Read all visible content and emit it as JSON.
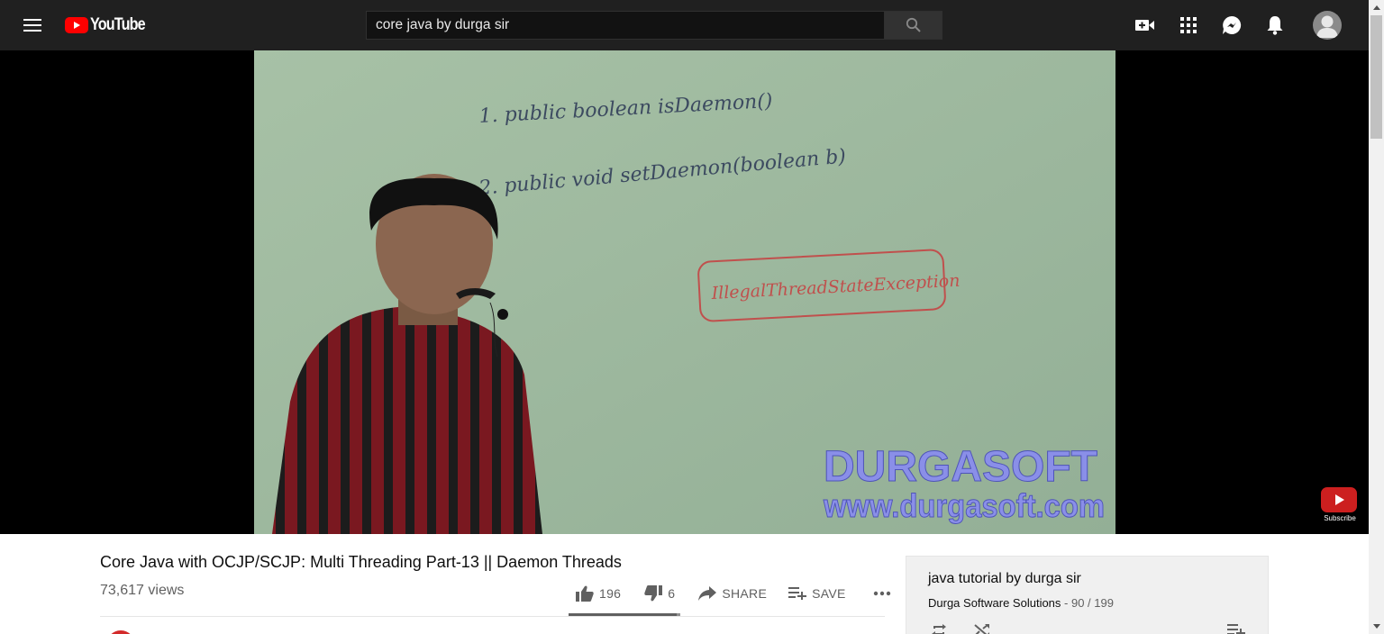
{
  "masthead": {
    "menu_icon": "hamburger-menu-icon",
    "logo_text": "YouTube",
    "search": {
      "value": "core java by durga sir",
      "placeholder": "Search"
    },
    "icons": [
      "create-video-icon",
      "apps-grid-icon",
      "messages-icon",
      "notifications-bell-icon",
      "account-avatar-icon"
    ]
  },
  "player": {
    "whiteboard": {
      "line1": "1. public boolean isDaemon()",
      "line2": "2. public void setDaemon(boolean b)",
      "exception": "IllegalThreadStateException"
    },
    "watermark_title": "DURGASOFT",
    "watermark_url": "www.durgasoft.com",
    "subscribe_label": "Subscribe"
  },
  "video": {
    "title": "Core Java with OCJP/SCJP: Multi Threading Part-13 || Daemon Threads",
    "views": "73,617 views",
    "likes": "196",
    "dislikes": "6",
    "share_label": "SHARE",
    "save_label": "SAVE",
    "like_ratio": 0.97
  },
  "playlist": {
    "title": "java tutorial by durga sir",
    "owner": "Durga Software Solutions",
    "position": " - 90 / 199"
  },
  "colors": {
    "masthead_bg": "#202020",
    "youtube_red": "#ff0000",
    "watermark_blue": "#8a8fe8",
    "whiteboard_green": "#9fbaa0",
    "exception_red": "#c0504d"
  }
}
